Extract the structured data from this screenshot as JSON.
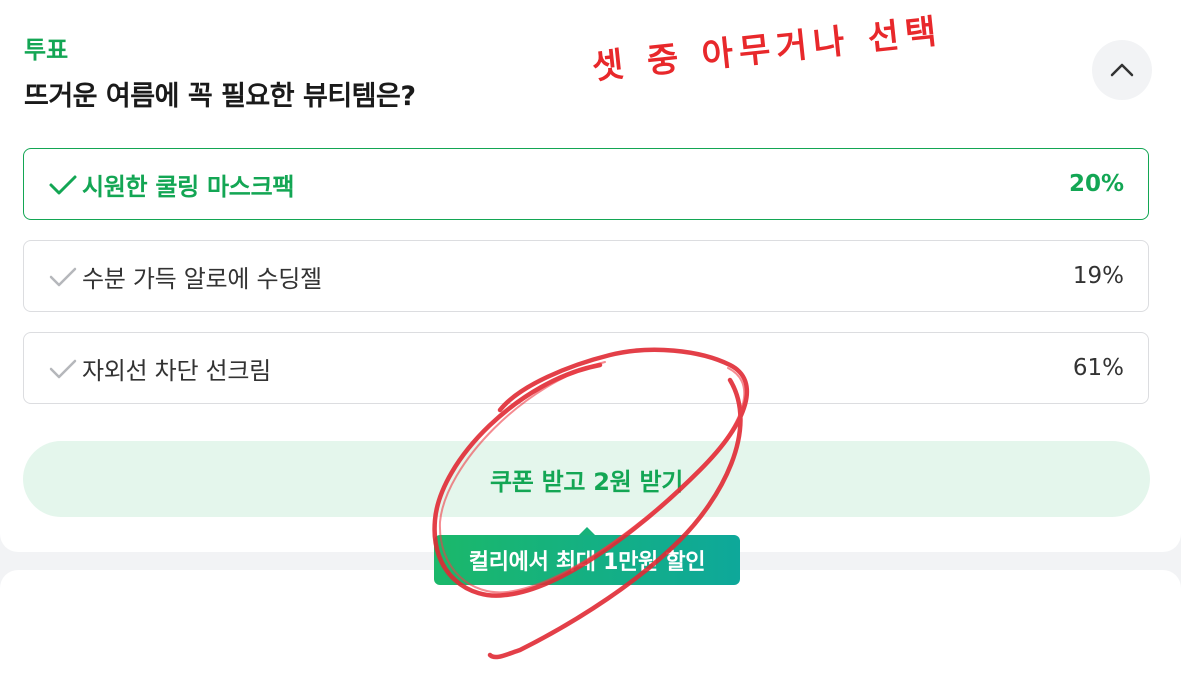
{
  "poll": {
    "label": "투표",
    "question": "뜨거운 여름에 꼭 필요한 뷰티템은?",
    "options": [
      {
        "label": "시원한 쿨링 마스크팩",
        "percent": "20%",
        "selected": true
      },
      {
        "label": "수분 가득 알로에 수딩젤",
        "percent": "19%",
        "selected": false
      },
      {
        "label": "자외선 차단 선크림",
        "percent": "61%",
        "selected": false
      }
    ],
    "coupon_button": "쿠폰 받고 2원 받기",
    "promo_tooltip": "컬리에서 최대 1만원 할인"
  },
  "annotation": {
    "handwritten_text": "셋 중 아무거나 선택",
    "color": "#e8282b"
  },
  "colors": {
    "accent": "#13a654",
    "coupon_bg": "#e4f6ec"
  },
  "icons": {
    "collapse": "chevron-up-icon",
    "check": "check-icon"
  }
}
